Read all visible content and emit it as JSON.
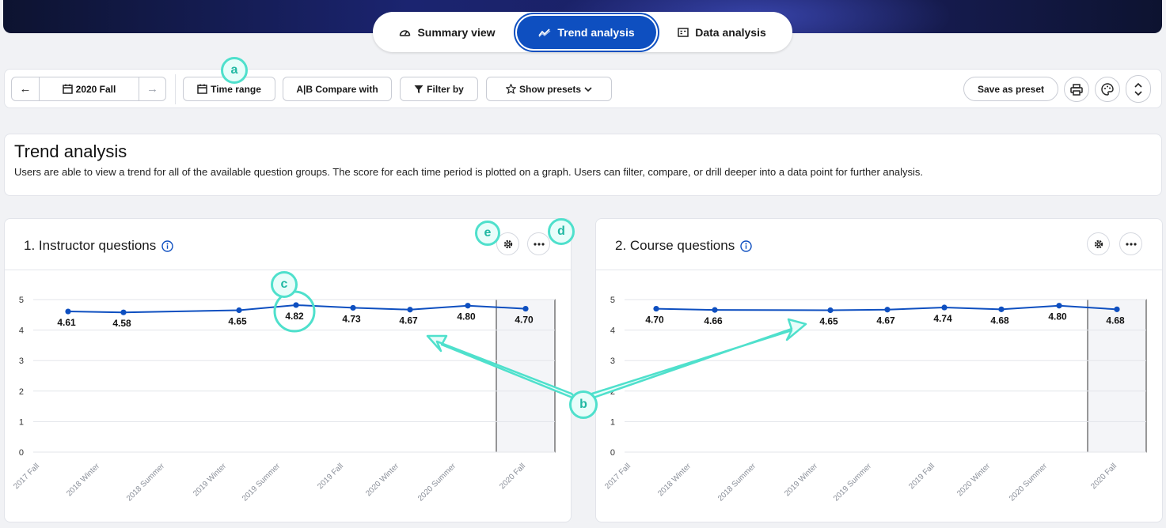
{
  "nav_tabs": [
    {
      "label": "Summary view",
      "icon": "gauge-icon",
      "active": false
    },
    {
      "label": "Trend analysis",
      "icon": "trend-icon",
      "active": true
    },
    {
      "label": "Data analysis",
      "icon": "table-icon",
      "active": false
    }
  ],
  "toolbar": {
    "period": "2020 Fall",
    "time_range": "Time range",
    "compare": "A|B Compare with",
    "filter": "Filter by",
    "presets": "Show presets",
    "save_preset": "Save as preset"
  },
  "intro": {
    "title": "Trend analysis",
    "description": "Users are able to view a trend for all of the available question groups. The score for each time period is plotted on a graph. Users can filter, compare, or drill deeper into a data point for further analysis."
  },
  "cards": [
    {
      "title": "1. Instructor questions"
    },
    {
      "title": "2. Course questions"
    }
  ],
  "annotations": [
    "a",
    "b",
    "c",
    "d",
    "e"
  ],
  "colors": {
    "accent": "#0e4fc0",
    "line": "#0e4fc0",
    "annotation": "#4fe0cc"
  },
  "chart_data": [
    {
      "type": "line",
      "title": "1. Instructor questions",
      "categories": [
        "2017 Fall",
        "2018 Winter",
        "2018 Summer",
        "2019 Winter",
        "2019 Summer",
        "2019 Fall",
        "2020 Winter",
        "2020 Summer",
        "2020 Fall"
      ],
      "x_positions": [
        0,
        1,
        2.8,
        3.6,
        4.2,
        5,
        6,
        7,
        8
      ],
      "points": [
        {
          "category": "2017 Fall",
          "value": 4.61
        },
        {
          "category": "2018 Winter",
          "value": 4.58
        },
        {
          "category": "2019 Winter",
          "value": 4.65
        },
        {
          "category": "2019 Summer",
          "value": 4.82
        },
        {
          "category": "2019 Fall",
          "value": 4.73
        },
        {
          "category": "2020 Winter",
          "value": 4.67
        },
        {
          "category": "2020 Summer",
          "value": 4.8
        },
        {
          "category": "2020 Fall",
          "value": 4.7
        }
      ],
      "y_ticks": [
        0,
        1,
        2,
        3,
        4,
        5
      ],
      "ylim": [
        0,
        5
      ],
      "highlight": "2020 Fall",
      "grid": true
    },
    {
      "type": "line",
      "title": "2. Course questions",
      "categories": [
        "2017 Fall",
        "2018 Winter",
        "2018 Summer",
        "2019 Winter",
        "2019 Summer",
        "2019 Fall",
        "2020 Winter",
        "2020 Summer",
        "2020 Fall"
      ],
      "points": [
        {
          "category": "2017 Fall",
          "value": 4.7
        },
        {
          "category": "2018 Winter",
          "value": 4.66
        },
        {
          "category": "2019 Winter",
          "value": 4.65
        },
        {
          "category": "2019 Summer",
          "value": 4.67
        },
        {
          "category": "2019 Fall",
          "value": 4.74
        },
        {
          "category": "2020 Winter",
          "value": 4.68
        },
        {
          "category": "2020 Summer",
          "value": 4.8
        },
        {
          "category": "2020 Fall",
          "value": 4.68
        }
      ],
      "y_ticks": [
        0,
        1,
        2,
        3,
        4,
        5
      ],
      "ylim": [
        0,
        5
      ],
      "highlight": "2020 Fall",
      "grid": true
    }
  ]
}
